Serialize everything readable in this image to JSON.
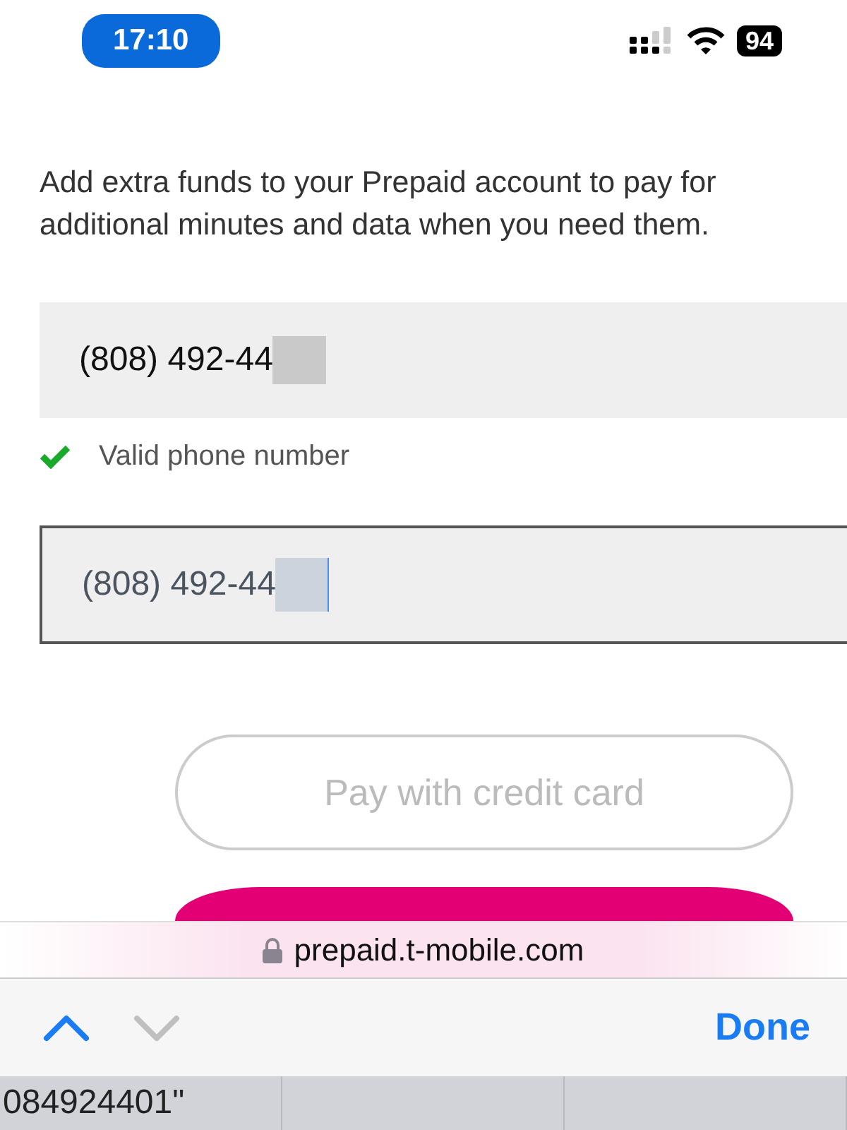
{
  "status_bar": {
    "time": "17:10",
    "battery": "94"
  },
  "description": "Add extra funds to your Prepaid account to pay for additional minutes and data when you need them.",
  "phone_field": {
    "value": "(808) 492-44"
  },
  "validation": {
    "valid": true,
    "message": "Valid phone number"
  },
  "confirm_field": {
    "value": "(808) 492-44",
    "focused": true
  },
  "buttons": [
    {
      "label": "Pay with credit card",
      "kind": "outline",
      "disabled": true
    },
    {
      "kind": "primary"
    }
  ],
  "address_bar": {
    "url": "prepaid.t-mobile.com",
    "secure": true
  },
  "keyboard_toolbar": {
    "previous_enabled": true,
    "next_enabled": false,
    "done": "Done"
  },
  "suggestions": [
    "084924401\""
  ]
}
